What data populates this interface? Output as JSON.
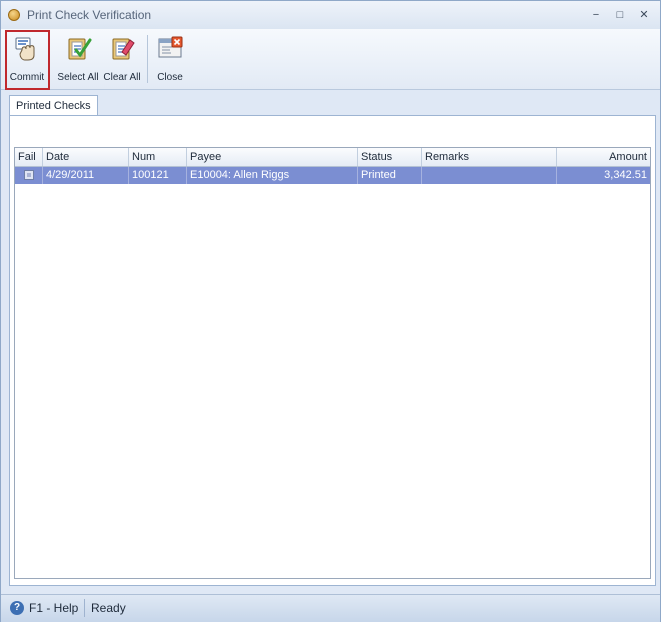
{
  "window": {
    "title": "Print Check Verification"
  },
  "title_buttons": {
    "minimize": "−",
    "maximize": "□",
    "close": "✕"
  },
  "toolbar": {
    "buttons": [
      {
        "label": "Commit",
        "icon": "commit-hand-icon"
      },
      {
        "label": "Select All",
        "icon": "checklist-icon"
      },
      {
        "label": "Clear All",
        "icon": "clear-eraser-icon"
      },
      {
        "label": "Close",
        "icon": "close-window-icon"
      }
    ],
    "highlight_color": "#c0282d"
  },
  "tabs": [
    {
      "label": "Printed Checks"
    }
  ],
  "grid": {
    "columns": [
      "Fail",
      "Date",
      "Num",
      "Payee",
      "Status",
      "Remarks",
      "Amount"
    ],
    "rows": [
      {
        "fail": false,
        "date": "4/29/2011",
        "num": "100121",
        "payee": "E10004: Allen Riggs",
        "status": "Printed",
        "remarks": "",
        "amount": "3,342.51"
      }
    ],
    "selected_row_color": "#7b8ed2"
  },
  "statusbar": {
    "help": "F1 - Help",
    "status": "Ready"
  }
}
